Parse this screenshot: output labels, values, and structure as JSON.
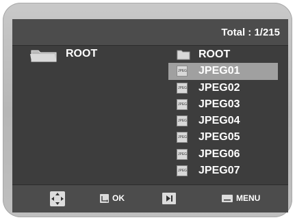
{
  "header": {
    "total_text": "Total : 1/215"
  },
  "left_panel": {
    "current_folder": "ROOT",
    "icon": "folder-open-icon"
  },
  "file_list": {
    "items": [
      {
        "label": "ROOT",
        "icon": "folder-icon",
        "selected": false
      },
      {
        "label": "JPEG01",
        "icon": "jpeg-file-icon",
        "selected": true
      },
      {
        "label": "JPEG02",
        "icon": "jpeg-file-icon",
        "selected": false
      },
      {
        "label": "JPEG03",
        "icon": "jpeg-file-icon",
        "selected": false
      },
      {
        "label": "JPEG04",
        "icon": "jpeg-file-icon",
        "selected": false
      },
      {
        "label": "JPEG05",
        "icon": "jpeg-file-icon",
        "selected": false
      },
      {
        "label": "JPEG06",
        "icon": "jpeg-file-icon",
        "selected": false
      },
      {
        "label": "JPEG07",
        "icon": "jpeg-file-icon",
        "selected": false
      }
    ]
  },
  "footer": {
    "ok_label": "OK",
    "menu_label": "MENU",
    "icons": [
      "direction-pad-icon",
      "enter-icon",
      "skip-icon",
      "menu-icon"
    ]
  },
  "colors": {
    "screen_bg": "#3d3d3d",
    "bar_bg": "#4c4c4c",
    "selection": "#a0a0a0",
    "text": "#ffffff"
  }
}
